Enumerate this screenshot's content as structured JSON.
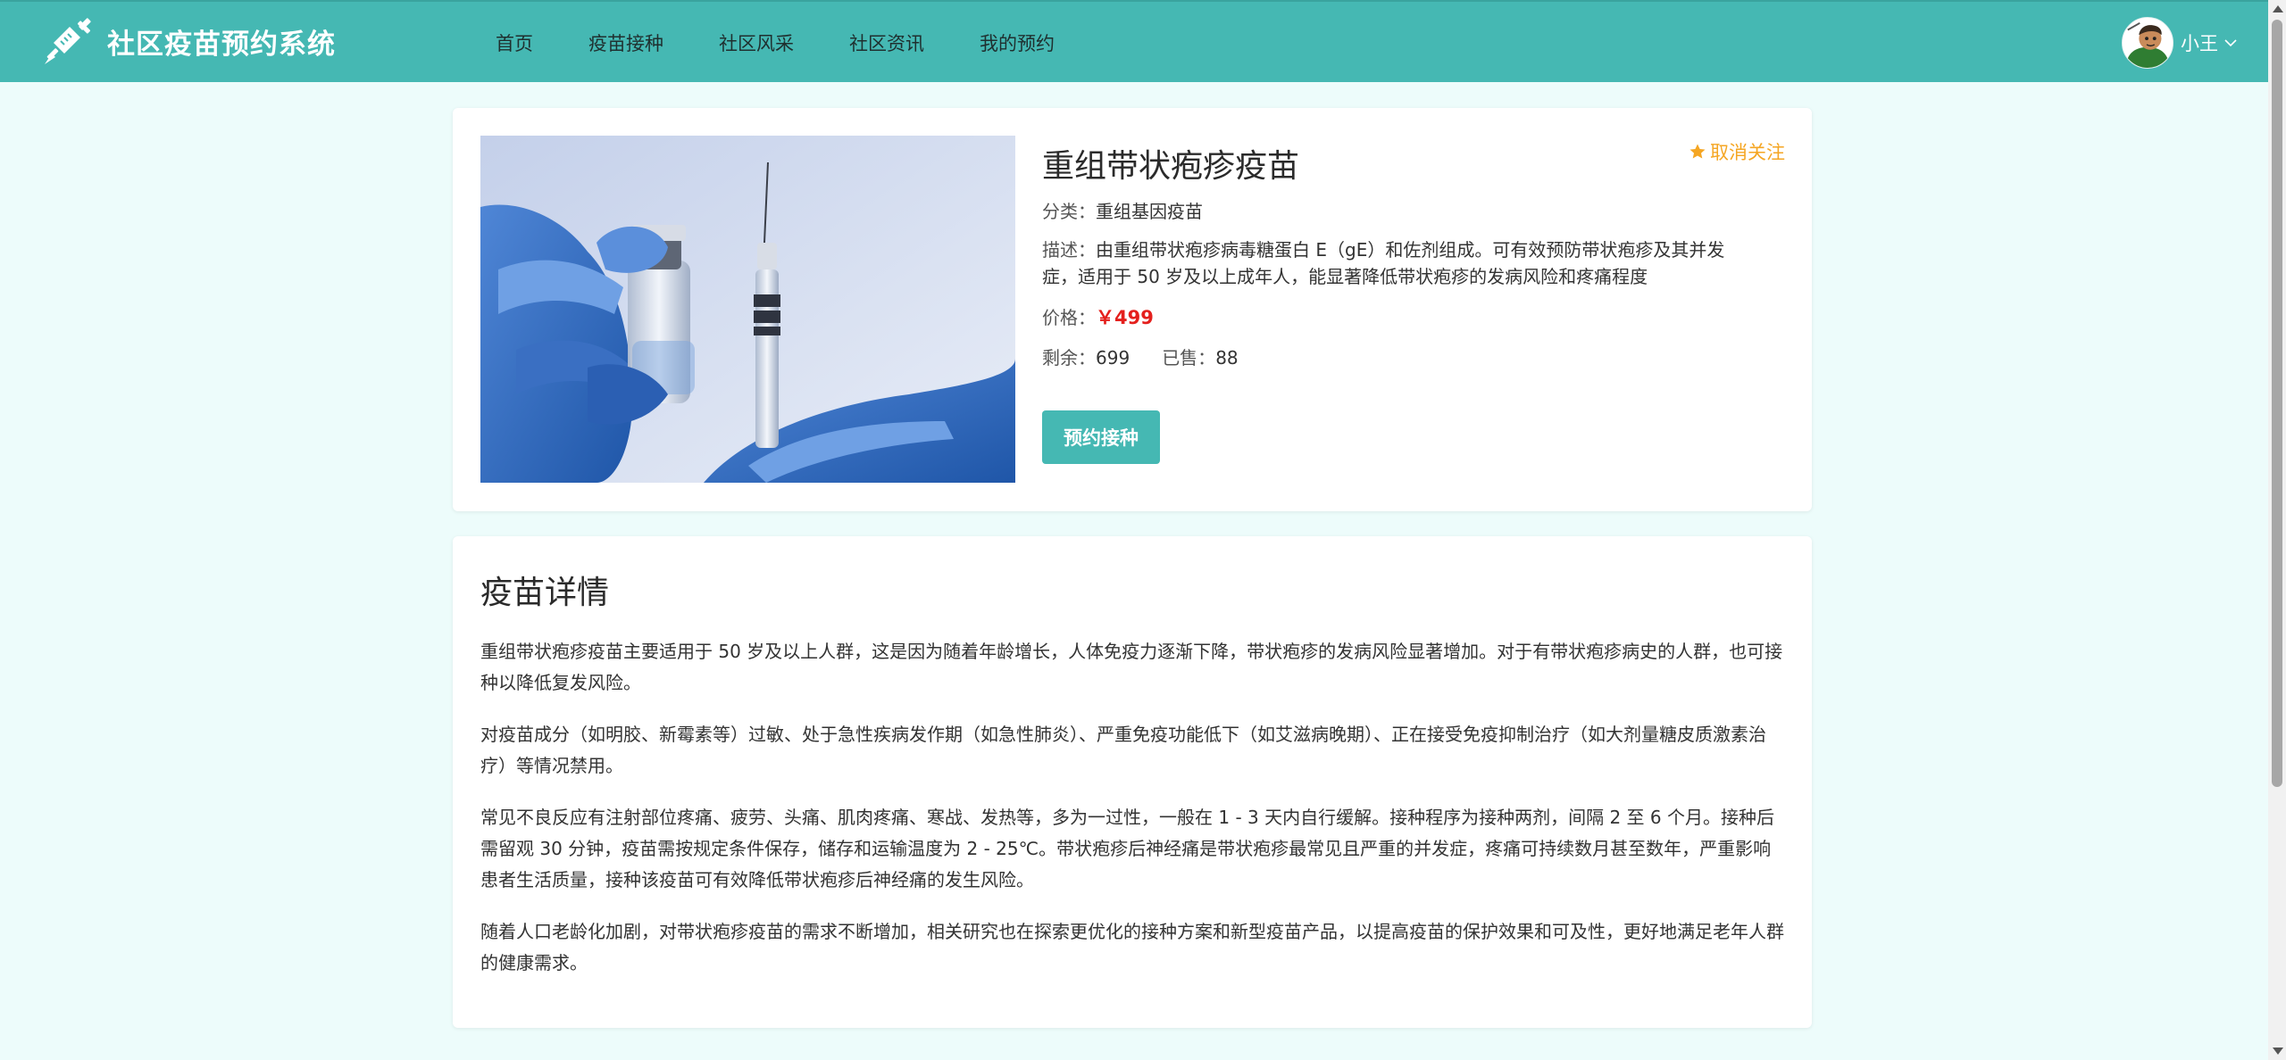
{
  "header": {
    "brand": "社区疫苗预约系统",
    "logo_icon": "syringe-icon",
    "nav": [
      {
        "label": "首页"
      },
      {
        "label": "疫苗接种"
      },
      {
        "label": "社区风采"
      },
      {
        "label": "社区资讯"
      },
      {
        "label": "我的预约"
      }
    ],
    "user": {
      "name": "小王",
      "avatar_icon": "user-avatar",
      "dropdown_icon": "chevron-down-icon"
    }
  },
  "product": {
    "name": "重组带状疱疹疫苗",
    "follow_label": "取消关注",
    "follow_icon": "star-icon",
    "category_label": "分类：",
    "category_value": "重组基因疫苗",
    "description_label": "描述：",
    "description_value": "由重组带状疱疹病毒糖蛋白 E（gE）和佐剂组成。可有效预防带状疱疹及其并发症，适用于 50 岁及以上成年人，能显著降低带状疱疹的发病风险和疼痛程度",
    "price_label": "价格：",
    "price_value": "￥499",
    "stock_label": "剩余：",
    "stock_value": "699",
    "sold_label": "已售：",
    "sold_value": "88",
    "book_button": "预约接种"
  },
  "detail": {
    "title": "疫苗详情",
    "paragraphs": [
      "重组带状疱疹疫苗主要适用于 50 岁及以上人群，这是因为随着年龄增长，人体免疫力逐渐下降，带状疱疹的发病风险显著增加。对于有带状疱疹病史的人群，也可接种以降低复发风险。",
      "对疫苗成分（如明胶、新霉素等）过敏、处于急性疾病发作期（如急性肺炎）、严重免疫功能低下（如艾滋病晚期）、正在接受免疫抑制治疗（如大剂量糖皮质激素治疗）等情况禁用。",
      "常见不良反应有注射部位疼痛、疲劳、头痛、肌肉疼痛、寒战、发热等，多为一过性，一般在 1 - 3 天内自行缓解。接种程序为接种两剂，间隔 2 至 6 个月。接种后需留观 30 分钟，疫苗需按规定条件保存，储存和运输温度为 2 - 25℃。带状疱疹后神经痛是带状疱疹最常见且严重的并发症，疼痛可持续数月甚至数年，严重影响患者生活质量，接种该疫苗可有效降低带状疱疹后神经痛的发生风险。",
      "随着人口老龄化加剧，对带状疱疹疫苗的需求不断增加，相关研究也在探索更优化的接种方案和新型疫苗产品，以提高疫苗的保护效果和可及性，更好地满足老年人群的健康需求。"
    ]
  },
  "colors": {
    "header_bg": "#45b8b3",
    "page_bg": "#edfcfb",
    "price": "#e4201d",
    "follow": "#f5a623",
    "button": "#45b8b3"
  }
}
